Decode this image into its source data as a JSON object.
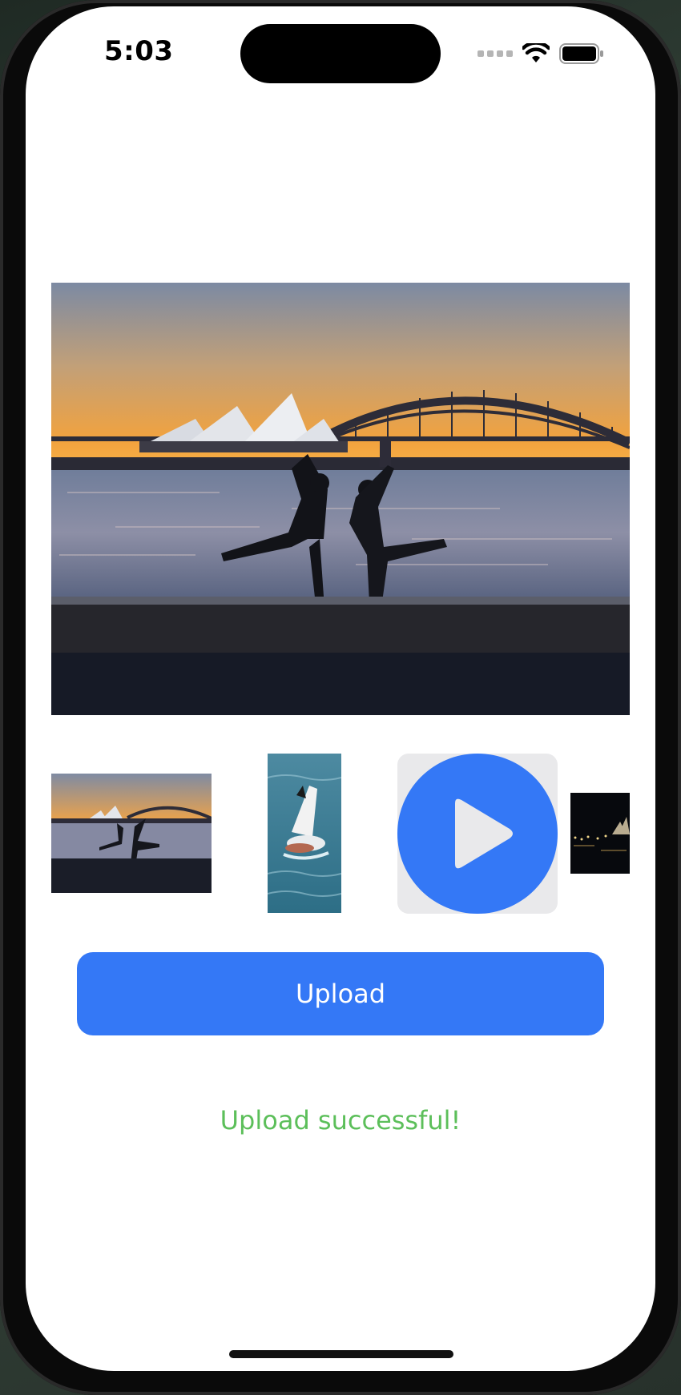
{
  "status_bar": {
    "time": "5:03",
    "icons": [
      "cellular-signal-icon",
      "wifi-icon",
      "battery-icon"
    ]
  },
  "hero": {
    "image": "sydney-opera-house-sunset-photo"
  },
  "thumbnails": [
    {
      "type": "photo",
      "image": "sydney-harbour-silhouette-photo"
    },
    {
      "type": "photo",
      "image": "seagull-water-photo"
    },
    {
      "type": "video",
      "icon": "play-icon"
    },
    {
      "type": "photo",
      "image": "sydney-night-photo"
    }
  ],
  "actions": {
    "upload_label": "Upload"
  },
  "status": {
    "message": "Upload successful!"
  },
  "colors": {
    "accent": "#3478f6",
    "success": "#5cbf5a",
    "video_tile_bg": "#e9e9eb"
  }
}
